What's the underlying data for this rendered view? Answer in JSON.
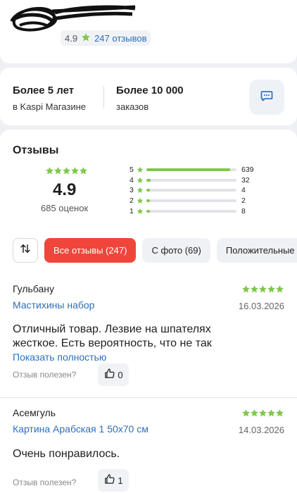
{
  "seller": {
    "rating": "4.9",
    "reviews_link": "247 отзывов"
  },
  "stats": {
    "years_big": "Более 5 лет",
    "years_small": "в Kaspi Магазине",
    "orders_big": "Более 10 000",
    "orders_small": "заказов"
  },
  "reviews": {
    "title": "Отзывы",
    "average": "4.9",
    "average_stars": 4.9,
    "count_label": "685 оценок",
    "distribution": [
      {
        "stars": "5",
        "count": "639",
        "fraction": 0.93
      },
      {
        "stars": "4",
        "count": "32",
        "fraction": 0.05
      },
      {
        "stars": "3",
        "count": "4",
        "fraction": 0.01
      },
      {
        "stars": "2",
        "count": "2",
        "fraction": 0.005
      },
      {
        "stars": "1",
        "count": "8",
        "fraction": 0.012
      }
    ],
    "filters": [
      "Все отзывы (247)",
      "С фото (69)",
      "Положительные"
    ],
    "active_filter": 0,
    "helpful_label": "Отзыв полезен?",
    "show_more": "Показать полностью",
    "items": [
      {
        "author": "Гульбану",
        "rating": 5,
        "product": "Мастихины набор",
        "date": "16.03.2026",
        "text": "Отличный товар. Лезвие на шпателях жесткое. Есть вероятность, что не так",
        "likes": "0"
      },
      {
        "author": "Асемгуль",
        "rating": 5,
        "product": "Картина Арабская 1 50х70 см",
        "date": "14.03.2026",
        "text": "Очень понравилось.",
        "likes": "1"
      }
    ]
  },
  "colors": {
    "accent_red": "#f0453a",
    "star_green": "#7fc84a",
    "link_blue": "#2c6fb8"
  },
  "icons": [
    "star-icon",
    "chat-icon",
    "sort-icon",
    "thumbs-up-icon"
  ]
}
